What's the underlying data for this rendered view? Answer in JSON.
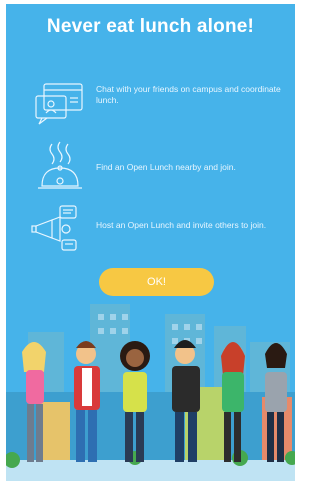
{
  "title": "Never eat lunch alone!",
  "features": [
    {
      "icon": "chat-icon",
      "text": "Chat with your friends on campus and coordinate lunch."
    },
    {
      "icon": "food-cloche-icon",
      "text": "Find an Open Lunch nearby and join."
    },
    {
      "icon": "megaphone-icon",
      "text": "Host an Open Lunch and invite others to join."
    }
  ],
  "ok_button": {
    "label": "OK!"
  },
  "colors": {
    "background": "#46b3ea",
    "button": "#f7c843",
    "text": "#ffffff"
  },
  "illustration": {
    "icon": "city-students-illustration"
  }
}
